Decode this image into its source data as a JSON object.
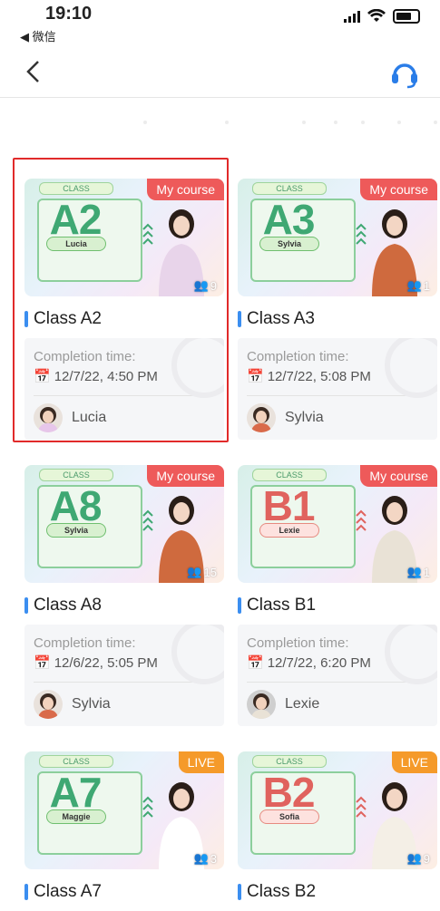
{
  "status_bar": {
    "time": "19:10",
    "back_app": "◀ 微信"
  },
  "nav": {
    "back_icon": "chevron-left-icon",
    "support_icon": "headset-icon"
  },
  "labels": {
    "completion_time": "Completion time:"
  },
  "colors": {
    "accent_blue": "#3b8ef0",
    "badge_red": "#ee5a5a",
    "badge_orange": "#f59a2a",
    "selection_red": "#e12a2a"
  },
  "cards": [
    {
      "code": "A2",
      "teacher": "Lucia",
      "badge": "My course",
      "count": "9",
      "title": "Class A2",
      "time": "12/7/22, 4:50 PM",
      "class_label": "CLASS"
    },
    {
      "code": "A3",
      "teacher": "Sylvia",
      "badge": "My course",
      "count": "1",
      "title": "Class A3",
      "time": "12/7/22, 5:08 PM",
      "class_label": "CLASS"
    },
    {
      "code": "A8",
      "teacher": "Sylvia",
      "badge": "My course",
      "count": "15",
      "title": "Class A8",
      "time": "12/6/22, 5:05 PM",
      "class_label": "CLASS"
    },
    {
      "code": "B1",
      "teacher": "Lexie",
      "badge": "My course",
      "count": "1",
      "title": "Class B1",
      "time": "12/7/22, 6:20 PM",
      "class_label": "CLASS"
    },
    {
      "code": "A7",
      "teacher": "Maggie",
      "badge": "LIVE",
      "count": "3",
      "title": "Class A7",
      "class_label": "CLASS"
    },
    {
      "code": "B2",
      "teacher": "Sofia",
      "badge": "LIVE",
      "count": "9",
      "title": "Class B2",
      "class_label": "CLASS"
    }
  ]
}
